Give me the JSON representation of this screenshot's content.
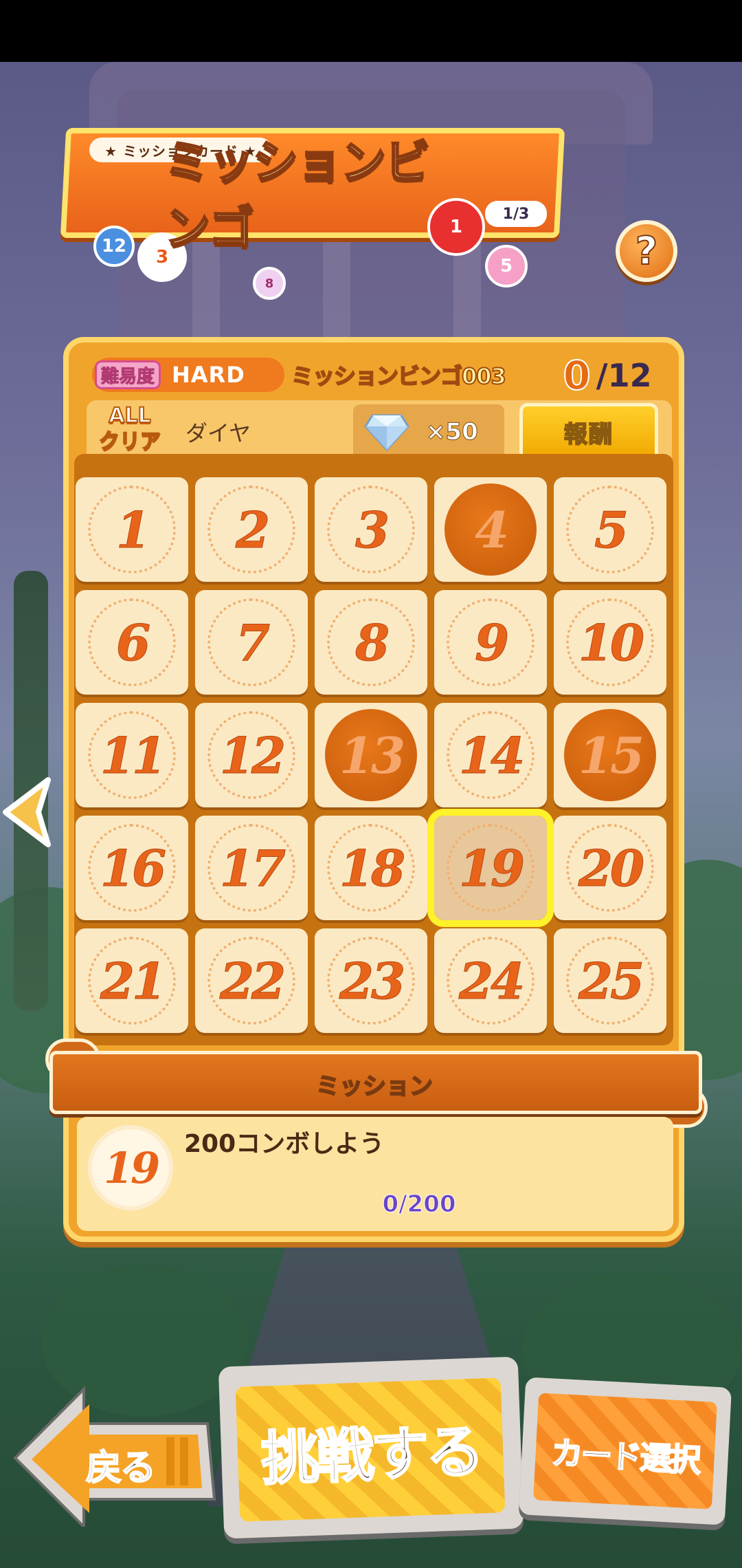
{
  "banner": {
    "tag": "★ ミッションカード ★",
    "title": "ミッションビンゴ",
    "page": "1/3",
    "balls": [
      "12",
      "3",
      "1",
      "5",
      "8"
    ]
  },
  "help": {
    "label": "?"
  },
  "card": {
    "difficulty_label": "難易度",
    "difficulty": "HARD",
    "name": "ミッションビンゴ003",
    "progress_current": "0",
    "progress_total": "/12",
    "allclear": [
      "ALL",
      "クリア"
    ],
    "reward_name": "ダイヤ",
    "reward_qty": "×50",
    "reward_button": "報酬"
  },
  "grid": {
    "cells": [
      "1",
      "2",
      "3",
      "4",
      "5",
      "6",
      "7",
      "8",
      "9",
      "10",
      "11",
      "12",
      "13",
      "14",
      "15",
      "16",
      "17",
      "18",
      "19",
      "20",
      "21",
      "22",
      "23",
      "24",
      "25"
    ],
    "completed": [
      "4",
      "13",
      "15"
    ],
    "selected": "19"
  },
  "mission": {
    "header": "ミッション",
    "number": "19",
    "text": "200コンボしよう",
    "progress": "0/200"
  },
  "buttons": {
    "back": "戻る",
    "challenge": "挑戦する",
    "card_select": "カード選択"
  },
  "colors": {
    "accent": "#f0a42c",
    "number": "#e8641a",
    "selected_outline": "#fff12a"
  }
}
